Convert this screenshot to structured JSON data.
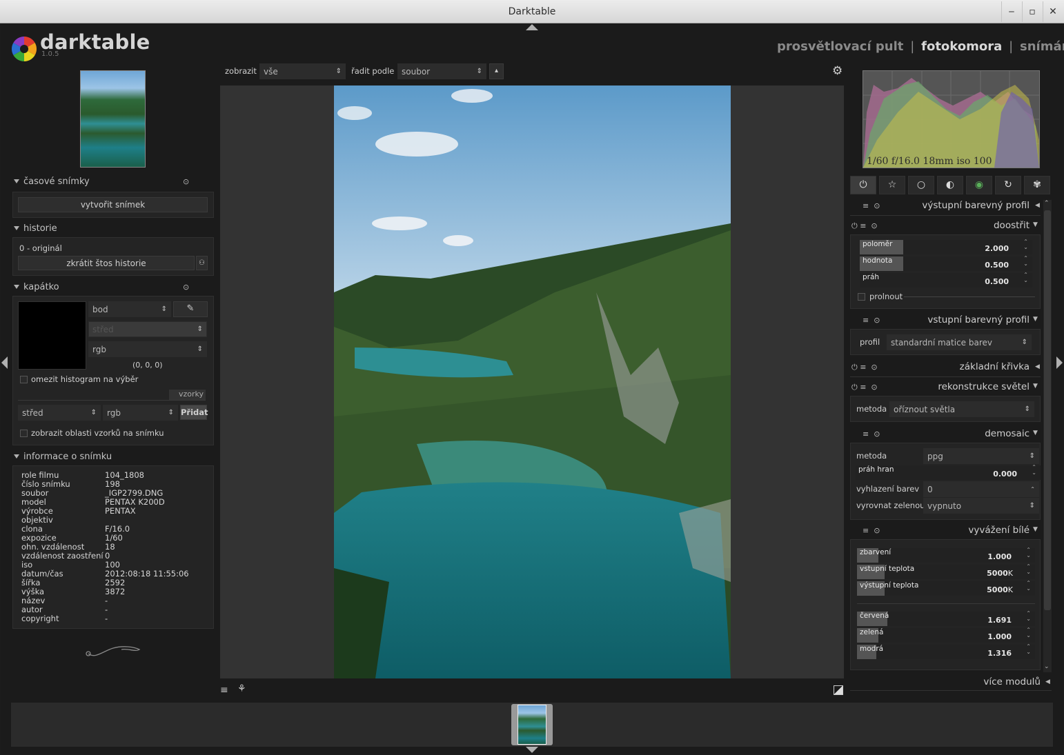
{
  "window": {
    "title": "Darktable",
    "minimize": "‒",
    "maximize": "▫",
    "close": "✕"
  },
  "app": {
    "name": "darktable",
    "version": "1.0.5"
  },
  "views": {
    "lighttable": "prosvětlovací pult",
    "sep1": "|",
    "darkroom": "fotokomora",
    "sep2": "|",
    "tethering": "snímání"
  },
  "toolbar": {
    "show_label": "zobrazit",
    "show_value": "vše",
    "sort_label": "řadit podle",
    "sort_value": "soubor",
    "sort_dir": "▴"
  },
  "left": {
    "snapshots": {
      "title": "časové snímky",
      "button": "vytvořit snímek"
    },
    "history": {
      "title": "historie",
      "item0": "0 - originál",
      "compress": "zkrátit štos historie"
    },
    "picker": {
      "title": "kapátko",
      "mode": "bod",
      "stat": "střed",
      "model": "rgb",
      "value": "(0, 0, 0)",
      "restrict": "omezit histogram na výběr",
      "samples_label": "vzorky",
      "sample_stat": "střed",
      "sample_model": "rgb",
      "add": "Přidat",
      "show_areas": "zobrazit oblasti vzorků na snímku"
    },
    "info": {
      "title": "informace o snímku",
      "rows": [
        {
          "k": "role filmu",
          "v": "104_1808"
        },
        {
          "k": "číslo snímku",
          "v": "198"
        },
        {
          "k": "soubor",
          "v": "_IGP2799.DNG"
        },
        {
          "k": "model",
          "v": "PENTAX K200D"
        },
        {
          "k": "výrobce",
          "v": "PENTAX"
        },
        {
          "k": "objektiv",
          "v": ""
        },
        {
          "k": "clona",
          "v": "F/16.0"
        },
        {
          "k": "expozice",
          "v": "1/60"
        },
        {
          "k": "ohn. vzdálenost",
          "v": "18"
        },
        {
          "k": "vzdálenost zaostření",
          "v": "0"
        },
        {
          "k": "iso",
          "v": "100"
        },
        {
          "k": "datum/čas",
          "v": "2012:08:18 11:55:06"
        },
        {
          "k": "šířka",
          "v": "2592"
        },
        {
          "k": "výška",
          "v": "3872"
        },
        {
          "k": "název",
          "v": "-"
        },
        {
          "k": "autor",
          "v": "-"
        },
        {
          "k": "copyright",
          "v": "-"
        }
      ]
    }
  },
  "histogram": {
    "exif": "1/60 f/16.0 18mm iso 100"
  },
  "modules": {
    "output_profile": "výstupní barevný profil",
    "sharpen": {
      "title": "doostřit",
      "radius_label": "poloměr",
      "radius": "2.000",
      "radius_fill": 0.25,
      "amount_label": "hodnota",
      "amount": "0.500",
      "amount_fill": 0.25,
      "threshold_label": "práh",
      "threshold": "0.500",
      "threshold_fill": 0.0,
      "blend": "prolnout"
    },
    "input_profile": {
      "title": "vstupní barevný profil",
      "profile_label": "profil",
      "profile": "standardní matice barev"
    },
    "base_curve": "základní křivka",
    "highlights": {
      "title": "rekonstrukce světel",
      "method_label": "metoda",
      "method": "oříznout světla"
    },
    "demosaic": {
      "title": "demosaic",
      "method_label": "metoda",
      "method": "ppg",
      "edge_label": "práh hran",
      "edge": "0.000",
      "smooth_label": "vyhlazení barev",
      "smooth": "0",
      "green_label": "vyrovnat zelenou",
      "green": "vypnuto"
    },
    "white_balance": {
      "title": "vyvážení bílé",
      "tint_label": "zbarvení",
      "tint": "1.000",
      "tint_fill": 0.12,
      "in_temp_label": "vstupní teplota",
      "in_temp": "5000",
      "unit": "K",
      "out_temp_label": "výstupní teplota",
      "out_temp": "5000",
      "red_label": "červená",
      "red": "1.691",
      "red_fill": 0.17,
      "green_label": "zelená",
      "green": "1.000",
      "green_fill": 0.12,
      "blue_label": "modrá",
      "blue": "1.316",
      "blue_fill": 0.11
    },
    "more": "více modulů"
  },
  "colors": {
    "accent": "#d0d0d0",
    "bg": "#1b1b1b"
  }
}
